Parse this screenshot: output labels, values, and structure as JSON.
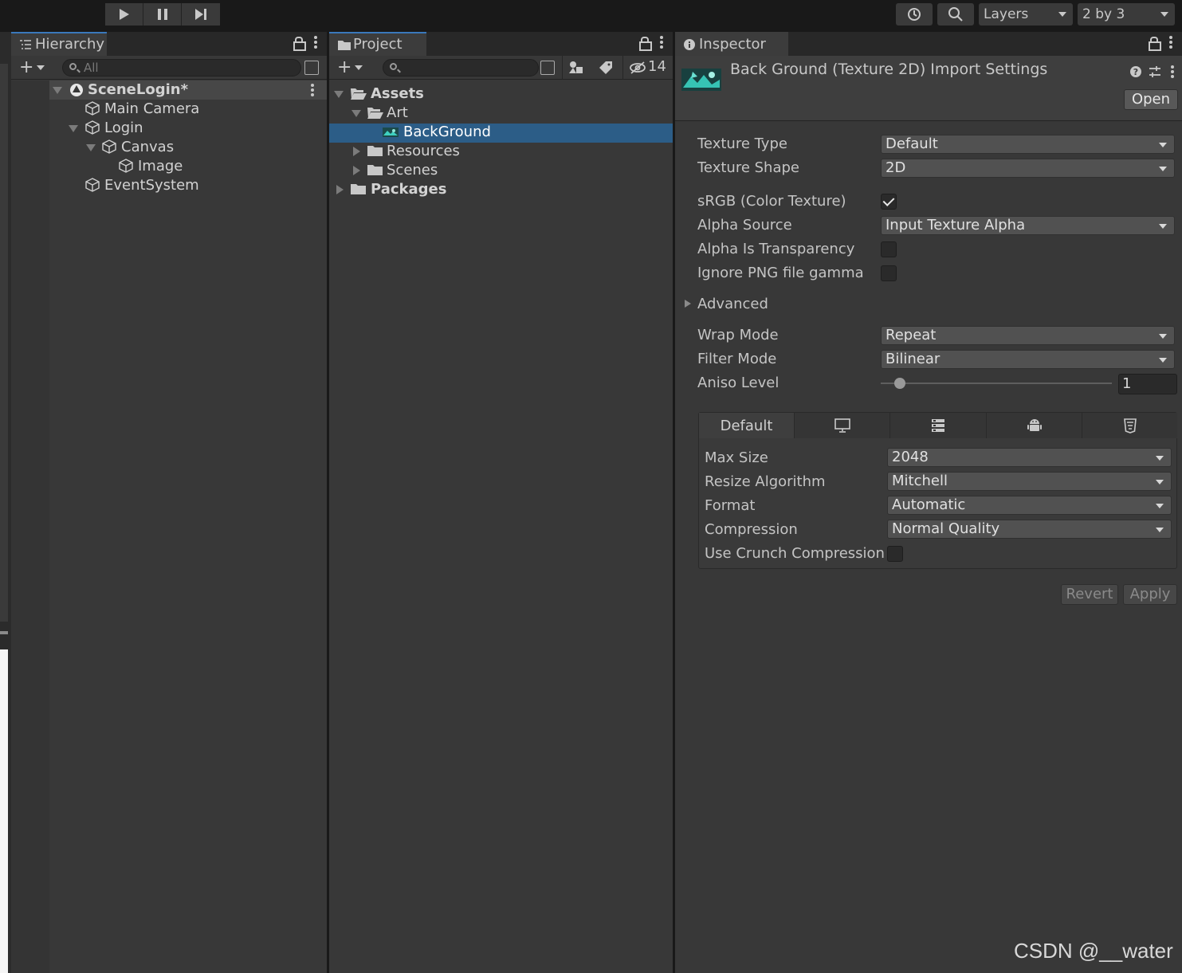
{
  "toolbar": {
    "layers_label": "Layers",
    "layout_label": "2 by 3"
  },
  "hierarchy": {
    "tab_label": "Hierarchy",
    "search_placeholder": "All",
    "items": [
      {
        "label": "SceneLogin*"
      },
      {
        "label": "Main Camera"
      },
      {
        "label": "Login"
      },
      {
        "label": "Canvas"
      },
      {
        "label": "Image"
      },
      {
        "label": "EventSystem"
      }
    ]
  },
  "project": {
    "tab_label": "Project",
    "hidden_count": "14",
    "tree": [
      {
        "label": "Assets"
      },
      {
        "label": "Art"
      },
      {
        "label": "BackGround"
      },
      {
        "label": "Resources"
      },
      {
        "label": "Scenes"
      },
      {
        "label": "Packages"
      }
    ]
  },
  "inspector": {
    "tab_label": "Inspector",
    "header_title": "Back Ground (Texture 2D) Import Settings",
    "open_button": "Open",
    "fields": {
      "texture_type": {
        "label": "Texture Type",
        "value": "Default"
      },
      "texture_shape": {
        "label": "Texture Shape",
        "value": "2D"
      },
      "srgb": {
        "label": "sRGB (Color Texture)",
        "checked": true
      },
      "alpha_source": {
        "label": "Alpha Source",
        "value": "Input Texture Alpha"
      },
      "alpha_transparency": {
        "label": "Alpha Is Transparency",
        "checked": false
      },
      "ignore_png_gamma": {
        "label": "Ignore PNG file gamma",
        "checked": false
      },
      "advanced": {
        "label": "Advanced"
      },
      "wrap_mode": {
        "label": "Wrap Mode",
        "value": "Repeat"
      },
      "filter_mode": {
        "label": "Filter Mode",
        "value": "Bilinear"
      },
      "aniso_level": {
        "label": "Aniso Level",
        "value": "1"
      }
    },
    "platform": {
      "default_tab": "Default",
      "tab_icons": [
        "monitor-icon",
        "server-icon",
        "android-icon",
        "html5-icon"
      ],
      "max_size": {
        "label": "Max Size",
        "value": "2048"
      },
      "resize_algorithm": {
        "label": "Resize Algorithm",
        "value": "Mitchell"
      },
      "format": {
        "label": "Format",
        "value": "Automatic"
      },
      "compression": {
        "label": "Compression",
        "value": "Normal Quality"
      },
      "crunch": {
        "label": "Use Crunch Compression",
        "checked": false
      }
    },
    "revert_button": "Revert",
    "apply_button": "Apply"
  },
  "watermark": "CSDN @__water",
  "colors": {
    "selection": "#2c5d87",
    "tab_accent": "#3a79bb",
    "panel_bg": "#383838"
  }
}
